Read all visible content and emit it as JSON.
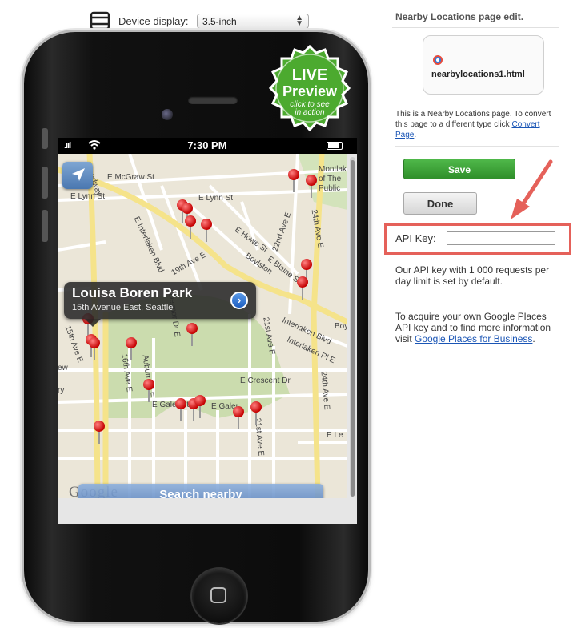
{
  "device_bar": {
    "label": "Device display:",
    "selected": "3.5-inch"
  },
  "phone": {
    "status": {
      "time": "7:30 PM"
    },
    "map": {
      "streets": [
        "E McGraw St",
        "E Lynn St",
        "E Lynn St",
        "Montlake",
        "of The",
        "Public",
        "22nd Ave E",
        "24th Ave E",
        "E Howe St",
        "E Blaine St",
        "19th Ave E",
        "Boylston",
        "E Interlaken Blvd",
        "15th Ave E",
        "Broadway",
        "Interlaken Blvd",
        "Interlaken Pl E",
        "Boy",
        "21st Ave E",
        "16th Ave E",
        "Auburn Pl E",
        "Delmar Dr E",
        "E Crescent Dr",
        "E Galer St",
        "E Galer",
        "21st Ave E",
        "24th Ave E",
        "E Le",
        "ew",
        "ry"
      ],
      "callout": {
        "title": "Louisa Boren Park",
        "subtitle": "15th Avenue East, Seattle"
      },
      "google": "Google",
      "search_button": "Search nearby"
    }
  },
  "live_preview": {
    "line1": "LIVE",
    "line2": "Preview",
    "line3": "click to see",
    "line4": "in action"
  },
  "panel": {
    "title": "Nearby Locations page edit.",
    "file_name": "nearbylocations1.html",
    "description": "This is a Nearby Locations page. To convert this page to a different type click ",
    "convert_link": "Convert Page",
    "description_end": ".",
    "save_label": "Save",
    "done_label": "Done",
    "api_label": "API Key:",
    "api_value": "",
    "info1": "Our API key with 1 000 requests per day limit is set by default.",
    "info2": "To acquire your own Google Places API key and to find more information visit ",
    "info2_link": "Google Places for Business",
    "info2_end": "."
  },
  "colors": {
    "save_green": "#3aa235",
    "highlight_red": "#e5615a",
    "link_blue": "#1a55b5"
  }
}
